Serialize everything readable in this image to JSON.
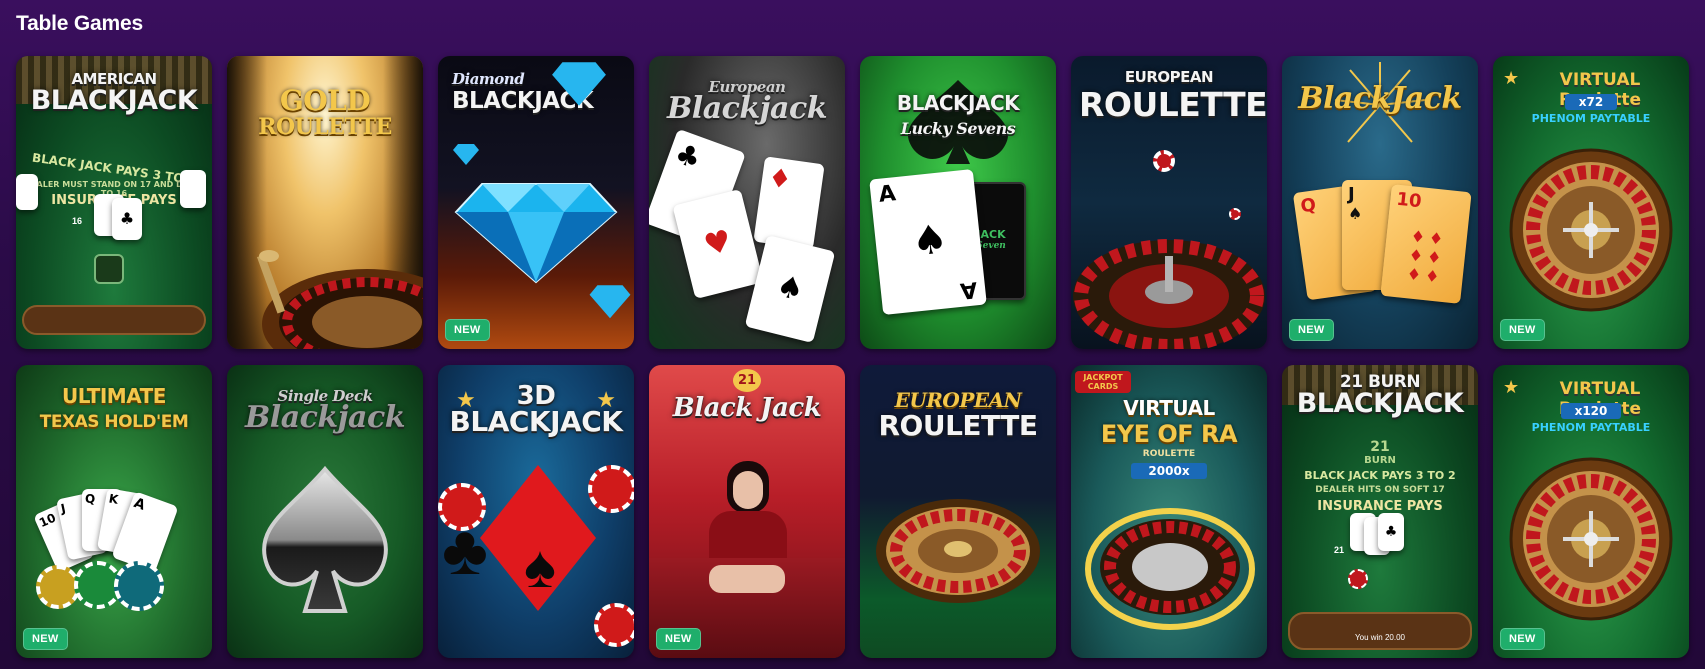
{
  "section": {
    "title": "Table Games"
  },
  "badge_new": "NEW",
  "games": [
    {
      "line1": "AMERICAN",
      "line2": "BLACKJACK",
      "felt_text_1": "BLACK JACK PAYS 3 TO 2",
      "felt_text_2": "DEALER MUST STAND ON 17 AND DRAW TO 16",
      "felt_text_3": "INSURANCE PAYS",
      "score": "16"
    },
    {
      "line1": "GOLD",
      "line2": "ROULETTE"
    },
    {
      "line1": "Diamond",
      "line2": "BLACKJACK"
    },
    {
      "line1": "European",
      "line2": "Blackjack"
    },
    {
      "line1": "BLACKJACK",
      "line2": "Lucky Sevens",
      "card_rank": "A",
      "back_line1": "JACK",
      "back_line2": "Seven"
    },
    {
      "line1": "EUROPEAN",
      "line2": "ROULETTE"
    },
    {
      "line1": "BlackJack",
      "card_q": "Q",
      "card_j": "J",
      "card_10": "10"
    },
    {
      "line1": "VIRTUAL Roulette",
      "mult": "x72",
      "sub": "PHENOM PAYTABLE"
    },
    {
      "line1": "ULTIMATE",
      "line2": "TEXAS HOLD'EM",
      "cards": [
        "10",
        "J",
        "Q",
        "K",
        "A"
      ]
    },
    {
      "line1": "Single Deck",
      "line2": "Blackjack"
    },
    {
      "line1": "3D",
      "line2": "BLACKJACK"
    },
    {
      "line1": "Black",
      "line2": "Jack",
      "badge_num": "21"
    },
    {
      "line1": "EUROPEAN",
      "line2": "ROULETTE"
    },
    {
      "corner": "JACKPOT CARDS",
      "line1": "VIRTUAL",
      "line2": "EYE OF RA",
      "line3": "ROULETTE",
      "mult": "2000x"
    },
    {
      "line1": "21 BURN",
      "line2": "BLACKJACK",
      "felt_num": "21",
      "felt_burn": "BURN",
      "felt_text_1": "BLACK JACK PAYS 3 TO 2",
      "felt_text_2": "DEALER HITS ON SOFT 17",
      "felt_text_3": "INSURANCE PAYS",
      "score": "21",
      "win": "You win 20.00"
    },
    {
      "line1": "VIRTUAL Roulette",
      "mult": "x120",
      "sub": "PHENOM PAYTABLE"
    }
  ],
  "new_flags": [
    false,
    false,
    true,
    false,
    false,
    false,
    true,
    true,
    true,
    false,
    false,
    true,
    false,
    false,
    false,
    true
  ],
  "colors": {
    "background": "#2a0b47",
    "badge_green": "#1fae6b",
    "felt_green": "#0f5a2a",
    "gold": "#f3c74b",
    "roulette_red": "#c0171d"
  },
  "icons": [
    "star-icon",
    "spade-icon",
    "club-icon",
    "diamond-gem-icon",
    "roulette-wheel-icon",
    "playing-card-icon",
    "casino-chip-icon"
  ]
}
